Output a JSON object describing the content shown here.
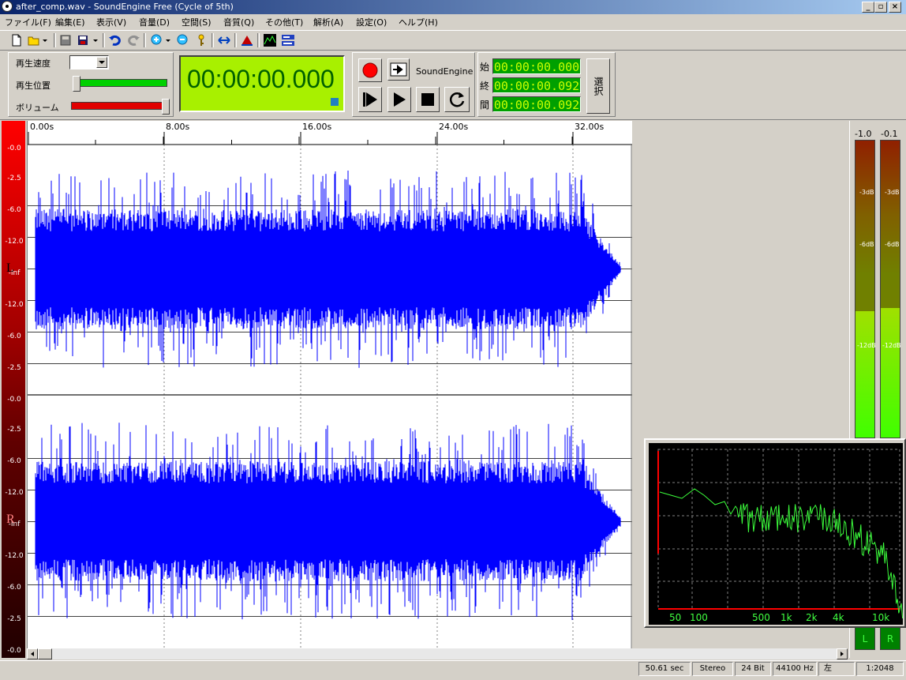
{
  "window": {
    "title": "after_comp.wav - SoundEngine Free (Cycle of 5th)"
  },
  "menu": [
    "ファイル(F)",
    "編集(E)",
    "表示(V)",
    "音量(D)",
    "空間(S)",
    "音質(Q)",
    "その他(T)",
    "解析(A)",
    "設定(O)",
    "ヘルプ(H)"
  ],
  "controls": {
    "speed_label": "再生速度",
    "position_label": "再生位置",
    "volume_label": "ボリューム",
    "time_display": "00:00:00.000",
    "brand": "SoundEngine",
    "start_label": "始",
    "end_label": "終",
    "length_label": "間",
    "start_time": "00:00:00.000",
    "end_time": "00:00:00.092",
    "length_time": "00:00:00.092",
    "select_button": "選択",
    "playback_position": 0.0,
    "volume_level": 1.0
  },
  "timeline": {
    "ticks": [
      "0.00s",
      "8.00s",
      "16.00s",
      "24.00s",
      "32.00s"
    ]
  },
  "scale": {
    "left_labels": [
      "-0.0",
      "-2.5",
      "-6.0",
      "-12.0",
      "-Inf",
      "-12.0",
      "-6.0",
      "-2.5",
      "-0.0"
    ],
    "right_labels": [
      "-2.5",
      "-6.0",
      "-12.0",
      "-Inf",
      "-12.0",
      "-6.0",
      "-2.5",
      "-0.0"
    ],
    "left_channel": "L",
    "right_channel": "R"
  },
  "meters": {
    "left_peak": "-1.0",
    "right_peak": "-0.1",
    "marks": [
      "-3dB",
      "-6dB",
      "-12dB"
    ],
    "left_level_db": -7.5,
    "right_level_db": -7.0,
    "left_button": "L",
    "right_button": "R"
  },
  "spectrum": {
    "freq_labels": [
      "50",
      "100",
      "500",
      "1k",
      "2k",
      "4k",
      "10k"
    ]
  },
  "status": [
    "50.61 sec",
    "Stereo",
    "24 Bit",
    "44100 Hz",
    "左",
    "1:2048"
  ],
  "colors": {
    "waveform": "#0000ff",
    "lcd": "#c8ff00",
    "spectrum_line": "#3cff3c",
    "record": "#ff0000"
  }
}
